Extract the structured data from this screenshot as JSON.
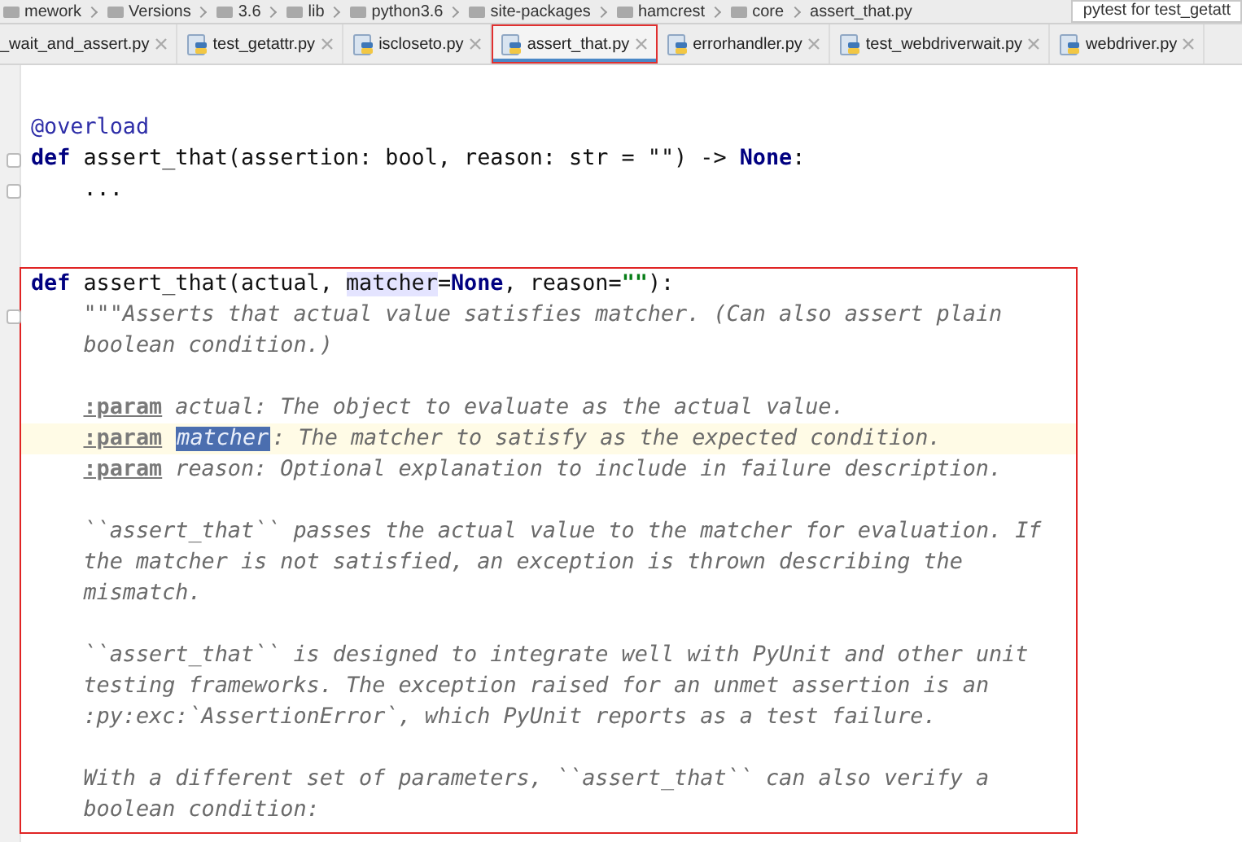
{
  "breadcrumb": {
    "items": [
      "mework",
      "Versions",
      "3.6",
      "lib",
      "python3.6",
      "site-packages",
      "hamcrest",
      "core",
      "assert_that.py"
    ],
    "run_config": "pytest for test_getatt"
  },
  "tabs": [
    {
      "label": "_wait_and_assert.py",
      "icon": false,
      "selected": false,
      "outlined": false
    },
    {
      "label": "test_getattr.py",
      "icon": true,
      "selected": false,
      "outlined": false
    },
    {
      "label": "iscloseto.py",
      "icon": true,
      "selected": false,
      "outlined": false
    },
    {
      "label": "assert_that.py",
      "icon": true,
      "selected": true,
      "outlined": true
    },
    {
      "label": "errorhandler.py",
      "icon": true,
      "selected": false,
      "outlined": false
    },
    {
      "label": "test_webdriverwait.py",
      "icon": true,
      "selected": false,
      "outlined": false
    },
    {
      "label": "webdriver.py",
      "icon": true,
      "selected": false,
      "outlined": false
    }
  ],
  "editor": {
    "blocks": [
      {
        "outlined": false,
        "lines": [
          {
            "kind": "blank",
            "current": false
          },
          {
            "kind": "code",
            "current": false,
            "fold": false,
            "indented": false,
            "segments": [
              {
                "kind": "decorator",
                "text": "@overload"
              }
            ]
          },
          {
            "kind": "code",
            "current": false,
            "fold": true,
            "indented": false,
            "segments": [
              {
                "kind": "keyword",
                "text": "def"
              },
              {
                "kind": "plain",
                "text": " assert_that(assertion: bool, reason: str = \"\") -> "
              },
              {
                "kind": "keyword",
                "text": "None"
              },
              {
                "kind": "plain",
                "text": ":"
              }
            ]
          },
          {
            "kind": "code",
            "current": false,
            "fold": true,
            "indented": true,
            "segments": [
              {
                "kind": "plain",
                "text": "..."
              }
            ]
          },
          {
            "kind": "blank",
            "current": false
          },
          {
            "kind": "blank",
            "current": false
          }
        ]
      },
      {
        "outlined": true,
        "lines": [
          {
            "kind": "code",
            "current": false,
            "fold": false,
            "indented": false,
            "segments": [
              {
                "kind": "keyword",
                "text": "def"
              },
              {
                "kind": "plain",
                "text": " assert_that(actual, "
              },
              {
                "kind": "usage",
                "text": "matcher"
              },
              {
                "kind": "plain",
                "text": "="
              },
              {
                "kind": "keyword",
                "text": "None"
              },
              {
                "kind": "plain",
                "text": ", reason="
              },
              {
                "kind": "string",
                "text": "\"\""
              },
              {
                "kind": "plain",
                "text": "):"
              }
            ]
          },
          {
            "kind": "code",
            "current": false,
            "fold": true,
            "indented": true,
            "segments": [
              {
                "kind": "docstring",
                "text": "\"\"\"Asserts that actual value satisfies matcher. (Can also assert plain"
              }
            ]
          },
          {
            "kind": "code",
            "current": false,
            "fold": false,
            "indented": true,
            "segments": [
              {
                "kind": "docstring",
                "text": "boolean condition.)"
              }
            ]
          },
          {
            "kind": "blank",
            "current": false
          },
          {
            "kind": "code",
            "current": false,
            "fold": false,
            "indented": true,
            "segments": [
              {
                "kind": "tag",
                "text": ":param"
              },
              {
                "kind": "docstring",
                "text": "actual: The object to evaluate as the actual value."
              }
            ]
          },
          {
            "kind": "code",
            "current": true,
            "fold": false,
            "indented": true,
            "segments": [
              {
                "kind": "tag",
                "text": ":param"
              },
              {
                "kind": "selection",
                "text": "matcher"
              },
              {
                "kind": "docstring",
                "text": ": The matcher to satisfy as the expected condition."
              }
            ]
          },
          {
            "kind": "code",
            "current": false,
            "fold": false,
            "indented": true,
            "segments": [
              {
                "kind": "tag",
                "text": ":param"
              },
              {
                "kind": "docstring",
                "text": "reason: Optional explanation to include in failure description."
              }
            ]
          },
          {
            "kind": "blank",
            "current": false
          },
          {
            "kind": "code",
            "current": false,
            "fold": false,
            "indented": true,
            "segments": [
              {
                "kind": "docstring",
                "text": "``assert_that`` passes the actual value to the matcher for evaluation. If"
              }
            ]
          },
          {
            "kind": "code",
            "current": false,
            "fold": false,
            "indented": true,
            "segments": [
              {
                "kind": "docstring",
                "text": "the matcher is not satisfied, an exception is thrown describing the"
              }
            ]
          },
          {
            "kind": "code",
            "current": false,
            "fold": false,
            "indented": true,
            "segments": [
              {
                "kind": "docstring",
                "text": "mismatch."
              }
            ]
          },
          {
            "kind": "blank",
            "current": false
          },
          {
            "kind": "code",
            "current": false,
            "fold": false,
            "indented": true,
            "segments": [
              {
                "kind": "docstring",
                "text": "``assert_that`` is designed to integrate well with PyUnit and other unit"
              }
            ]
          },
          {
            "kind": "code",
            "current": false,
            "fold": false,
            "indented": true,
            "segments": [
              {
                "kind": "docstring",
                "text": "testing frameworks. The exception raised for an unmet assertion is an"
              }
            ]
          },
          {
            "kind": "code",
            "current": false,
            "fold": false,
            "indented": true,
            "segments": [
              {
                "kind": "docstring",
                "text": ":py:exc:`AssertionError`, which PyUnit reports as a test failure."
              }
            ]
          },
          {
            "kind": "blank",
            "current": false
          },
          {
            "kind": "code",
            "current": false,
            "fold": false,
            "indented": true,
            "segments": [
              {
                "kind": "docstring",
                "text": "With a different set of parameters, ``assert_that`` can also verify a"
              }
            ]
          },
          {
            "kind": "code",
            "current": false,
            "fold": false,
            "indented": true,
            "segments": [
              {
                "kind": "docstring",
                "text": "boolean condition:"
              }
            ]
          }
        ]
      }
    ]
  }
}
